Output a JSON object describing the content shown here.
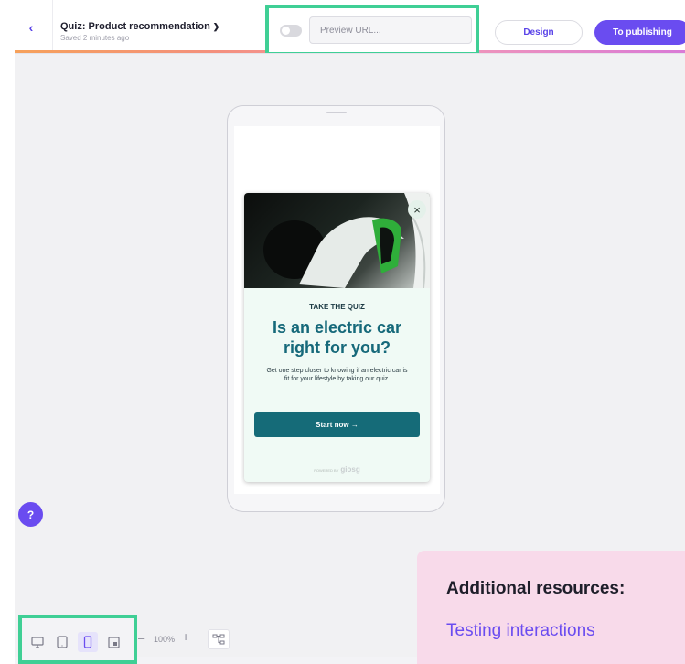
{
  "header": {
    "back_icon": "chevron-left-icon",
    "quiz_title": "Quiz: Product recommendation",
    "saved_status": "Saved 2 minutes ago",
    "preview_toggle_on": false,
    "preview_url_placeholder": "Preview URL...",
    "design_label": "Design",
    "publish_label": "To publishing"
  },
  "quiz_card": {
    "eyebrow": "TAKE THE QUIZ",
    "headline_line1": "Is an electric car",
    "headline_line2": "right for you?",
    "body": "Get one step closer to knowing if an electric car is fit for your lifestyle by taking our quiz.",
    "cta_label": "Start now →",
    "powered_prefix": "POWERED BY",
    "powered_brand": "giosg",
    "close_icon": "close-icon"
  },
  "help": {
    "label": "?"
  },
  "toolbar": {
    "devices": [
      {
        "name": "desktop-icon",
        "active": false
      },
      {
        "name": "tablet-icon",
        "active": false
      },
      {
        "name": "mobile-icon",
        "active": true
      },
      {
        "name": "fullscreen-icon",
        "active": false
      }
    ],
    "zoom_minus": "–",
    "zoom_level": "100%",
    "zoom_plus": "+",
    "tree_icon": "sitemap-icon"
  },
  "resources": {
    "title": "Additional resources:",
    "link": "Testing interactions"
  },
  "colors": {
    "accent": "#6a4cf0",
    "highlight": "#3fcf95",
    "quiz_primary": "#156b78",
    "resources_bg": "#f8daea"
  }
}
